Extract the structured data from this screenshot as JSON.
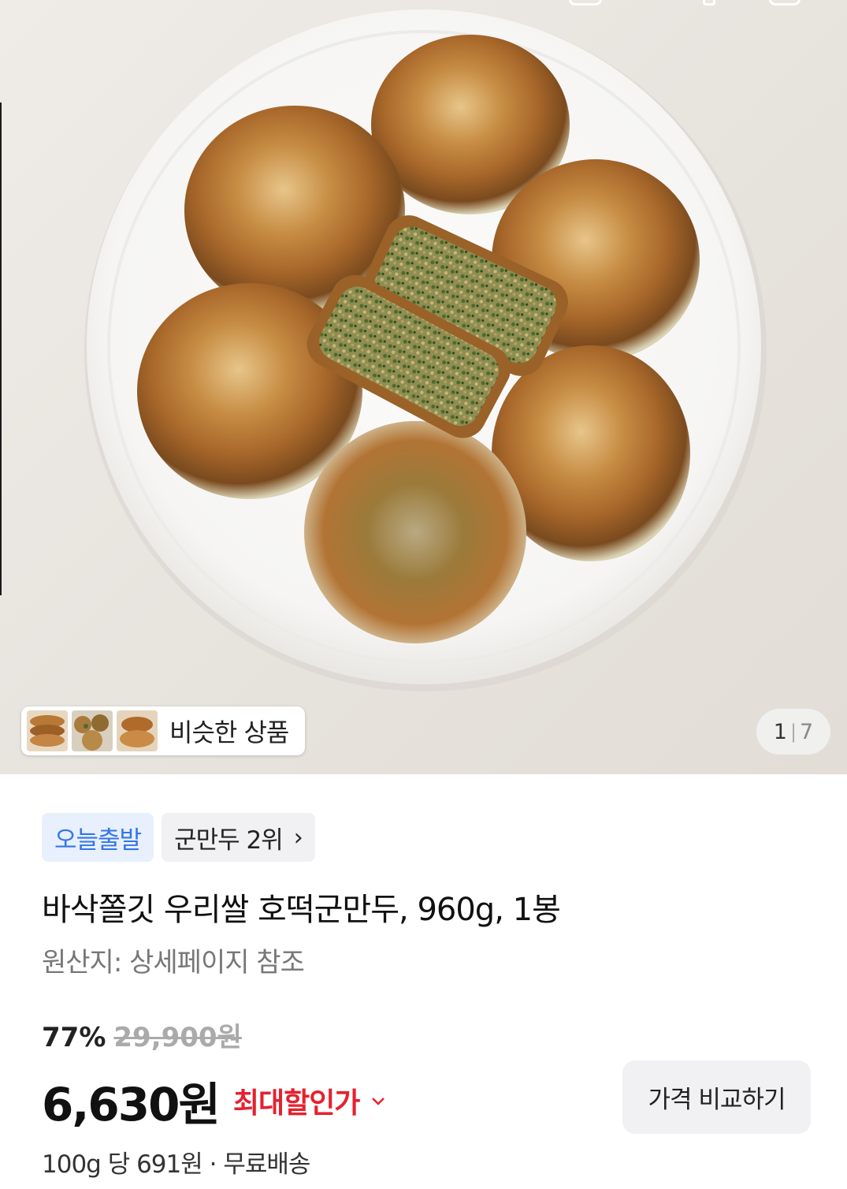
{
  "gallery": {
    "similar_label": "비슷한 상품",
    "counter_current": "1",
    "counter_separator": "|",
    "counter_total": "7",
    "thumbnail_count": 3
  },
  "badges": {
    "delivery": "오늘출발",
    "rank": "군만두 2위",
    "rank_chevron": "›"
  },
  "product": {
    "title": "바삭쫄깃 우리쌀 호떡군만두, 960g, 1봉",
    "origin": "원산지: 상세페이지 참조"
  },
  "pricing": {
    "discount_rate": "77%",
    "original_price": "29,900원",
    "sale_price": "6,630원",
    "max_discount_label": "최대할인가",
    "max_discount_chevron": "⌄",
    "compare_button": "가격 비교하기",
    "unit_price": "100g 당 691원",
    "shipping_separator": "·",
    "shipping": "무료배송"
  },
  "colors": {
    "delivery_badge_text": "#3476e8",
    "delivery_badge_bg": "#e8f0fd",
    "max_discount": "#e5212f",
    "original_price": "#aaaaaa"
  }
}
